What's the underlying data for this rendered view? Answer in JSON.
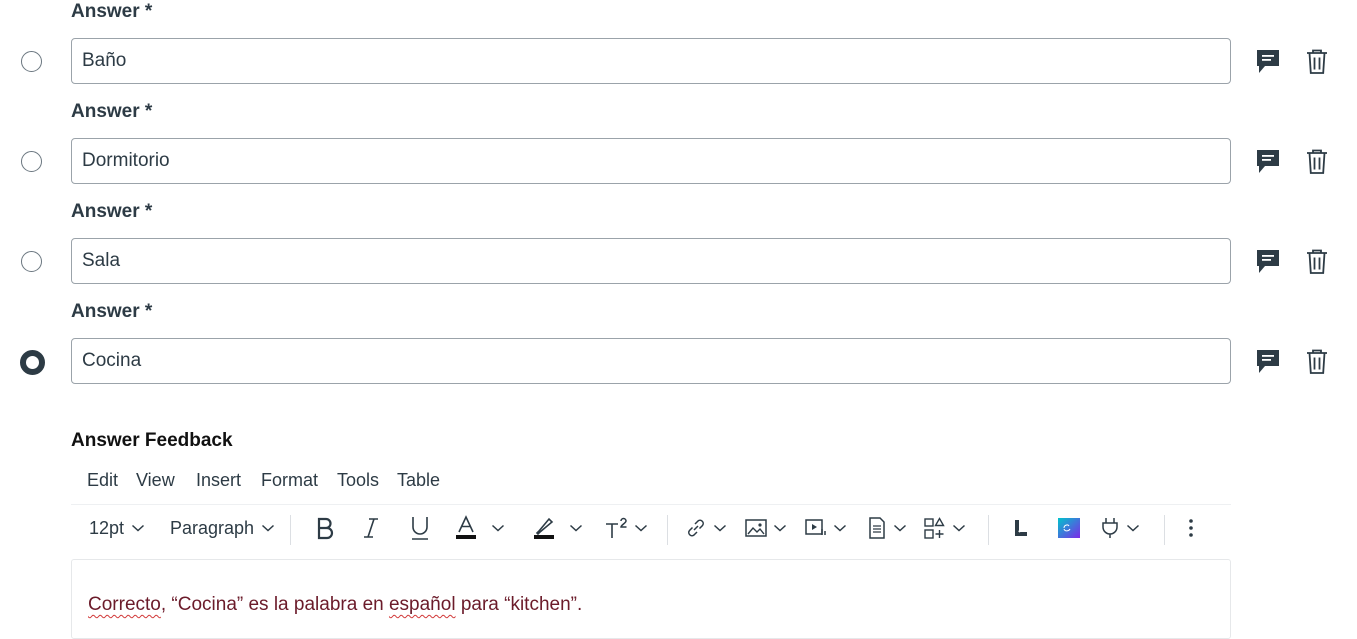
{
  "answers": [
    {
      "label": "Answer *",
      "value": "Baño",
      "selected": false
    },
    {
      "label": "Answer *",
      "value": "Dormitorio",
      "selected": false
    },
    {
      "label": "Answer *",
      "value": "Sala",
      "selected": false
    },
    {
      "label": "Answer *",
      "value": "Cocina",
      "selected": true
    }
  ],
  "feedback": {
    "title": "Answer Feedback",
    "menubar": [
      "Edit",
      "View",
      "Insert",
      "Format",
      "Tools",
      "Table"
    ],
    "toolbar": {
      "font_size": "12pt",
      "block_format": "Paragraph"
    },
    "content": {
      "part1": "Correcto",
      "part2": ", “Cocina” es la palabra en ",
      "part3": "español",
      "part4": " para “kitchen”."
    }
  },
  "icons": {
    "feedback": "comment-icon",
    "delete": "trash-icon"
  },
  "colors": {
    "text": "#2d3b45",
    "feedback_text": "#6b1b2a",
    "icon": "#2d3b45",
    "spellcheck": "#d13737"
  }
}
